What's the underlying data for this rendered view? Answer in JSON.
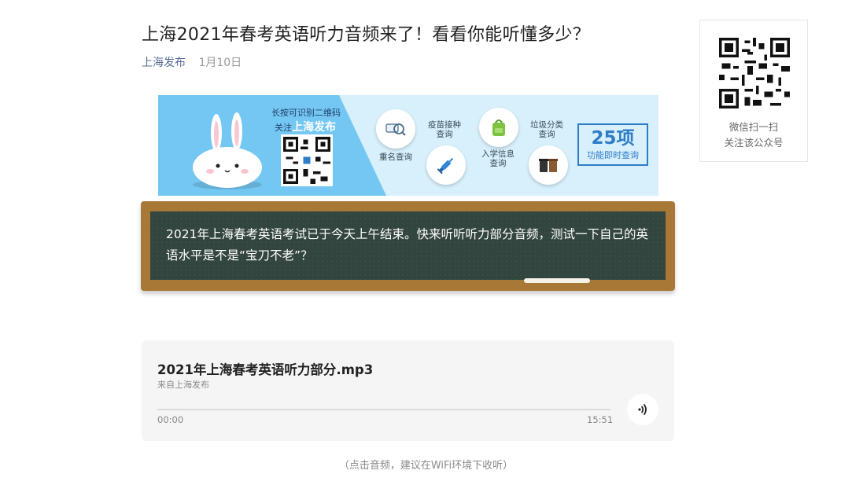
{
  "article": {
    "title": "上海2021年春考英语听力音频来了！看看你能听懂多少？",
    "author": "上海发布",
    "date": "1月10日"
  },
  "qr_card": {
    "caption_line1": "微信扫一扫",
    "caption_line2": "关注该公众号"
  },
  "banner": {
    "promo_line1": "长按可识别二维码",
    "promo_prefix": "关注",
    "promo_account": "上海发布",
    "services": [
      {
        "label": "重名查询",
        "icon": "search-icon"
      },
      {
        "label": "疫苗接种\n查询",
        "icon": "syringe-icon"
      },
      {
        "label": "入学信息\n查询",
        "icon": "school-bag-icon"
      },
      {
        "label": "垃圾分类\n查询",
        "icon": "trash-bin-icon"
      }
    ],
    "badge_big": "25项",
    "badge_small": "功能即时查询",
    "colors": {
      "light": "#d7f0fc",
      "dark": "#74c7f2",
      "accent": "#2f7cc6"
    }
  },
  "blackboard": {
    "text": "2021年上海春考英语考试已于今天上午结束。快来听听听力部分音频，测试一下自己的英语水平是不是“宝刀不老”？"
  },
  "audio": {
    "file_name": "2021年上海春考英语听力部分.mp3",
    "source": "来自上海发布",
    "current_time": "00:00",
    "duration": "15:51",
    "progress": 0,
    "play_icon": "audio-wave-icon"
  },
  "hint": "（点击音频，建议在WiFi环境下收听）"
}
